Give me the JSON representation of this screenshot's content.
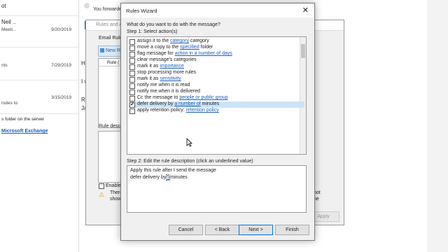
{
  "mail_list": [
    {
      "name": "ot",
      "subject": "",
      "date": ""
    },
    {
      "name": "Neil ..",
      "subject": "Meeti...",
      "date": "9/20/2019"
    },
    {
      "name": "",
      "subject": "nts",
      "date": "7/29/2019"
    },
    {
      "name": "",
      "subject": "nutes to",
      "date": "3/15/2019"
    }
  ],
  "folder_note": "s folder on the server",
  "exchange_label": "Microsoft Exchange",
  "reading_header": "You forwarde",
  "reading_body": [
    "Hi g",
    "I wa",
    "Reg",
    "Jaco"
  ],
  "rules_alerts": {
    "title": "Rules and A",
    "email_rules_label": "Email Rule",
    "new_rule_label": "New R",
    "column_rule": "Rule (",
    "rule_description_label": "Rule descr",
    "enable_label": "Enable",
    "warning_text": [
      "There",
      "show"
    ],
    "apply_label": "Apply",
    "right_text": [
      "not",
      "ne"
    ]
  },
  "wizard": {
    "title": "Rules Wizard",
    "question": "What do you want to do with the message?",
    "step1": "Step 1: Select action(s)",
    "actions": [
      {
        "checked": false,
        "prefix": "assign it to the ",
        "link": "category",
        "suffix": " category"
      },
      {
        "checked": false,
        "prefix": "move a copy to the ",
        "link": "specified",
        "suffix": " folder"
      },
      {
        "checked": false,
        "prefix": "flag message for ",
        "link": "action in a number of days",
        "suffix": ""
      },
      {
        "checked": false,
        "prefix": "clear message's categories",
        "link": "",
        "suffix": ""
      },
      {
        "checked": false,
        "prefix": "mark it as ",
        "link": "importance",
        "suffix": ""
      },
      {
        "checked": false,
        "prefix": "stop processing more rules",
        "link": "",
        "suffix": ""
      },
      {
        "checked": false,
        "prefix": "mark it as ",
        "link": "sensitivity",
        "suffix": ""
      },
      {
        "checked": false,
        "prefix": "notify me when it is read",
        "link": "",
        "suffix": ""
      },
      {
        "checked": false,
        "prefix": "notify me when it is delivered",
        "link": "",
        "suffix": ""
      },
      {
        "checked": false,
        "prefix": "Cc the message to ",
        "link": "people or public group",
        "suffix": ""
      },
      {
        "checked": true,
        "prefix": "defer delivery by ",
        "link": "a number of",
        "suffix": " minutes"
      },
      {
        "checked": false,
        "prefix": "apply retention policy: ",
        "link": "retention policy",
        "suffix": ""
      }
    ],
    "step2": "Step 2: Edit the rule description (click an underlined value)",
    "description": [
      "Apply this rule after I send the message",
      "defer delivery by",
      "5",
      "minutes"
    ],
    "buttons": {
      "cancel": "Cancel",
      "back": "< Back",
      "next": "Next >",
      "finish": "Finish"
    }
  }
}
